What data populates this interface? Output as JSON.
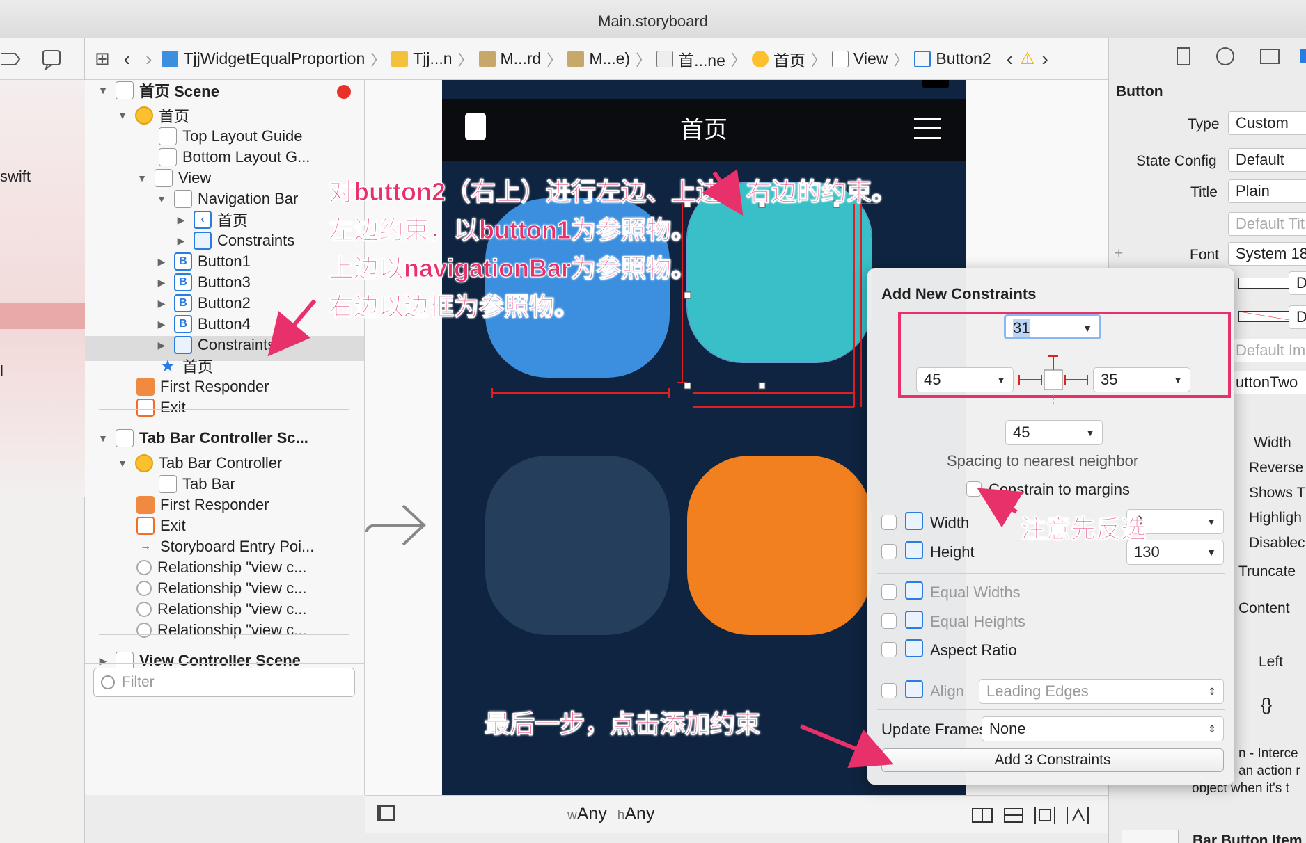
{
  "window": {
    "title": "Main.storyboard"
  },
  "left_strip": {
    "label_swift": "swift",
    "label_l": "l"
  },
  "jumpbar": {
    "items": [
      "TjjWidgetEqualProportion",
      "Tjj...n",
      "M...rd",
      "M...e)",
      "首...ne",
      "首页",
      "View",
      "Button2"
    ]
  },
  "outline": {
    "rows": [
      "首页 Scene",
      "首页",
      "Top Layout Guide",
      "Bottom Layout G...",
      "View",
      "Navigation Bar",
      "首页",
      "Constraints",
      "Button1",
      "Button3",
      "Button2",
      "Button4",
      "Constraints",
      "首页",
      "First Responder",
      "Exit",
      "Tab Bar Controller Sc...",
      "Tab Bar Controller",
      "Tab Bar",
      "First Responder",
      "Exit",
      "Storyboard Entry Poi...",
      "Relationship \"view c...",
      "Relationship \"view c...",
      "Relationship \"view c...",
      "Relationship \"view c...",
      "View Controller Scene"
    ],
    "filter_placeholder": "Filter"
  },
  "canvas": {
    "nav_title": "首页",
    "size_class_w": "w",
    "size_class_w_value": "Any",
    "size_class_h": "h",
    "size_class_h_value": "Any"
  },
  "inspector": {
    "section": "Button",
    "type_label": "Type",
    "type_value": "Custom",
    "state_label": "State Config",
    "state_value": "Default",
    "title_label": "Title",
    "title_value": "Plain",
    "title_placeholder": "Default Tit",
    "font_label": "Font",
    "font_value": "System 18",
    "de1": "De",
    "de2": "De",
    "default_image": "Default Im",
    "button_two": "uttonTwo",
    "width": "Width",
    "reverse": "Reverse",
    "shows": "Shows T",
    "highlight": "Highligh",
    "disabled": "Disablec",
    "truncate": "Truncate",
    "content": "Content",
    "left": "Left",
    "braces": "{}",
    "desc1": "n - Interce",
    "desc2": "an action r",
    "desc3": "object when it's t",
    "bar_button": "Bar Button Item"
  },
  "popover": {
    "title": "Add New Constraints",
    "top": "31",
    "left": "45",
    "right": "35",
    "bottom": "45",
    "spacing_label": "Spacing to nearest neighbor",
    "constrain_margins": "Constrain to margins",
    "width_label": "Width",
    "width_value": "0",
    "height_label": "Height",
    "height_value": "130",
    "equal_widths": "Equal Widths",
    "equal_heights": "Equal Heights",
    "aspect_ratio": "Aspect Ratio",
    "align_label": "Align",
    "align_value": "Leading Edges",
    "update_frames_label": "Update Frames",
    "update_frames_value": "None",
    "add_button": "Add 3 Constraints"
  },
  "annotations": {
    "line1": "对button2（右上）进行左边、上边、右边的约束。",
    "line2": "左边约束，以button1为参照物。",
    "line3": "上边以navigationBar为参照物。",
    "line4": "右边以边框为参照物。",
    "note_margins": "注意先反选",
    "final_step": "最后一步，点击添加约束"
  },
  "colors": {
    "annotation": "#e8316b",
    "tile_blue": "#3b8fde",
    "tile_teal": "#39bfc7",
    "tile_navy": "#253e5c",
    "tile_orange": "#f2801f",
    "phone_bg": "#0f2440"
  }
}
